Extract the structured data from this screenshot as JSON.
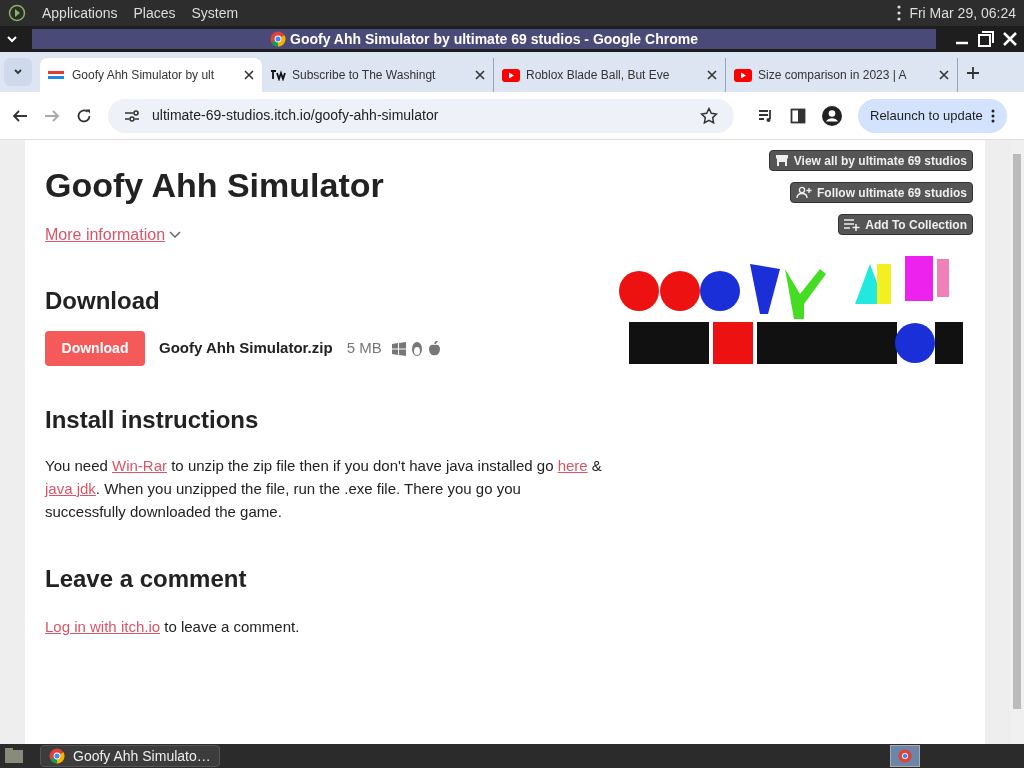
{
  "top_panel": {
    "menus": [
      "Applications",
      "Places",
      "System"
    ],
    "clock": "Fri Mar 29, 06:24"
  },
  "window": {
    "title": "Goofy Ahh Simulator by ultimate 69 studios - Google Chrome"
  },
  "tabs": [
    {
      "label": "Goofy Ahh Simulator by ult",
      "selected": true,
      "kind": "game"
    },
    {
      "label": "Subscribe to The Washingt",
      "selected": false,
      "kind": "news"
    },
    {
      "label": "Roblox Blade Ball, But Eve",
      "selected": false,
      "kind": "video"
    },
    {
      "label": "Size comparison in 2023 | A",
      "selected": false,
      "kind": "video"
    }
  ],
  "address_bar": {
    "url": "ultimate-69-studios.itch.io/goofy-ahh-simulator"
  },
  "relaunch_button": "Relaunch to update",
  "page": {
    "title": "Goofy Ahh Simulator",
    "more_info": "More information",
    "side_buttons": [
      {
        "label": "View all by ultimate 69 studios",
        "kind": "store"
      },
      {
        "label": "Follow ultimate 69 studios",
        "kind": "follow"
      },
      {
        "label": "Add To Collection",
        "kind": "collection"
      }
    ],
    "download_heading": "Download",
    "download_button": "Download",
    "file_name": "Goofy Ahh Simulator.zip",
    "file_size": "5 MB",
    "install_heading": "Install instructions",
    "install_text": [
      {
        "text": "You need "
      },
      {
        "text": "Win-Rar",
        "link": true
      },
      {
        "text": " to unzip the zip file then if you don't have java installed go "
      },
      {
        "text": "here",
        "link": true
      },
      {
        "text": " & "
      },
      {
        "text": "java jdk",
        "link": true
      },
      {
        "text": ". When you unzipped the file, run the .exe file. There you go you successfully downloaded the game."
      }
    ],
    "comment_heading": "Leave a comment",
    "comment_text": [
      {
        "text": "Log in with itch.io",
        "link": true
      },
      {
        "text": " to leave a comment."
      }
    ]
  },
  "taskbar": {
    "window_button": "Goofy Ahh Simulato…"
  }
}
